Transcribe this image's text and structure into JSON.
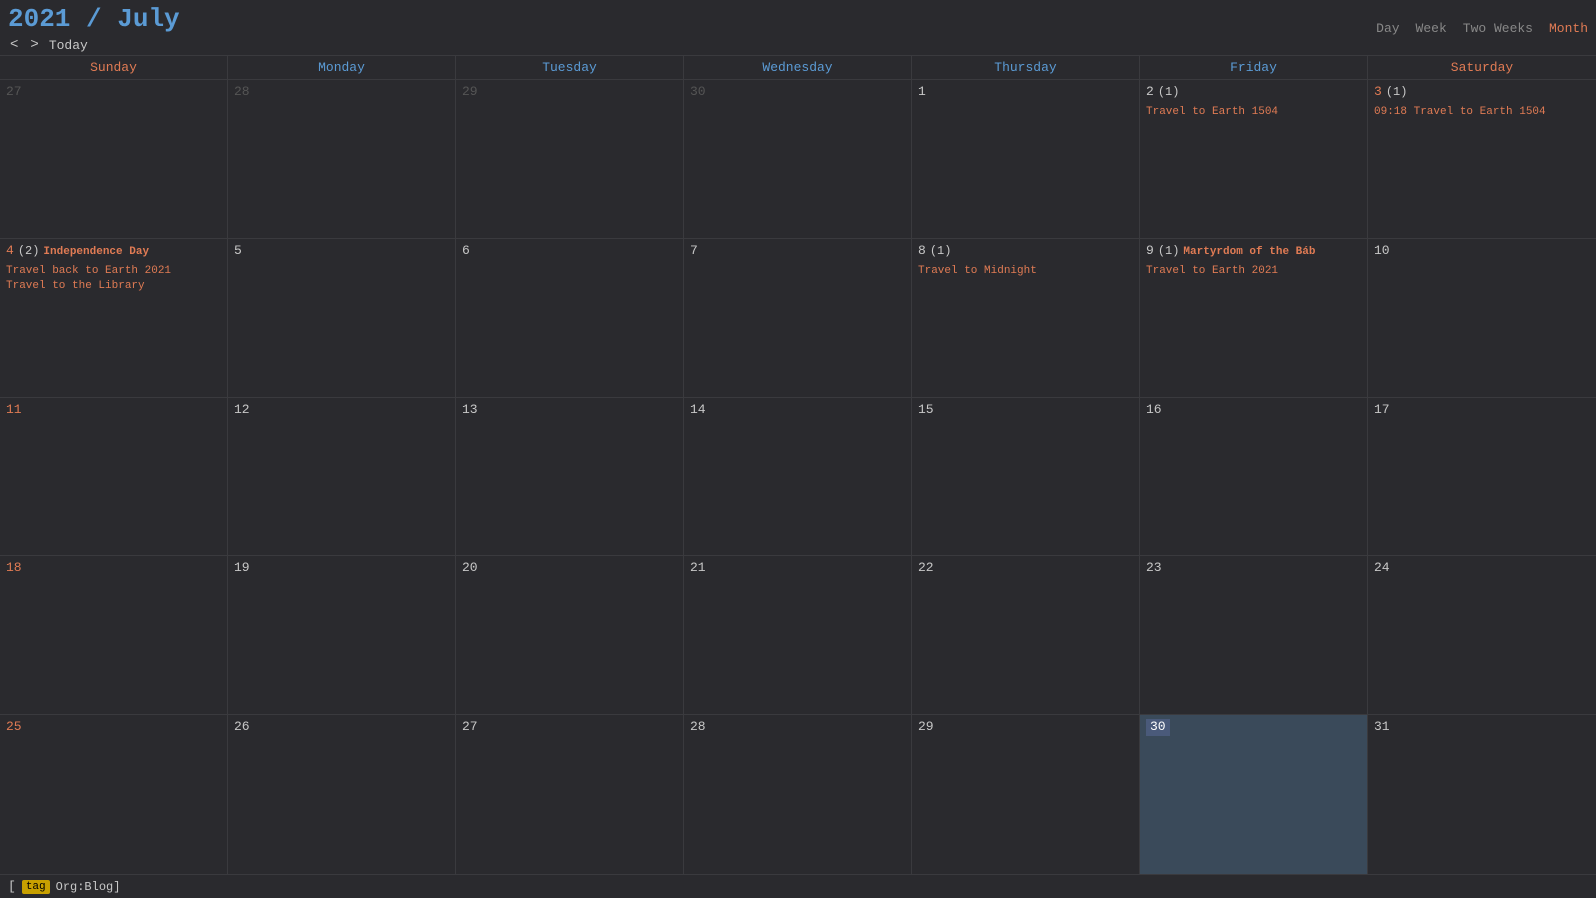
{
  "header": {
    "title_year": "2021",
    "title_sep": " / ",
    "title_month": "July",
    "nav_prev": "<",
    "nav_next": ">",
    "nav_today": "Today"
  },
  "view_switcher": {
    "day": "Day",
    "week": "Week",
    "two_weeks": "Two Weeks",
    "month": "Month"
  },
  "day_headers": [
    {
      "label": "Sunday",
      "type": "weekend"
    },
    {
      "label": "Monday",
      "type": "weekday"
    },
    {
      "label": "Tuesday",
      "type": "weekday"
    },
    {
      "label": "Wednesday",
      "type": "weekday"
    },
    {
      "label": "Thursday",
      "type": "weekday"
    },
    {
      "label": "Friday",
      "type": "weekday"
    },
    {
      "label": "Saturday",
      "type": "weekend"
    }
  ],
  "weeks": [
    [
      {
        "num": "27",
        "type": "other"
      },
      {
        "num": "28",
        "type": "other"
      },
      {
        "num": "29",
        "type": "other"
      },
      {
        "num": "30",
        "type": "other"
      },
      {
        "num": "1",
        "type": "current"
      },
      {
        "num": "2",
        "type": "current",
        "count": "(1)",
        "events": [
          {
            "text": "Travel to Earth 1504",
            "style": "orange"
          }
        ]
      },
      {
        "num": "3",
        "type": "weekend",
        "count": "(1)",
        "events": [
          {
            "text": "09:18 Travel to Earth 1504",
            "style": "orange"
          }
        ]
      }
    ],
    [
      {
        "num": "4",
        "type": "weekend",
        "count": "(2)",
        "events": [
          {
            "text": "Independence Day",
            "style": "bold-orange"
          },
          {
            "text": "Travel back to Earth 2021",
            "style": "orange"
          },
          {
            "text": "Travel to the Library",
            "style": "orange"
          }
        ]
      },
      {
        "num": "5",
        "type": "current"
      },
      {
        "num": "6",
        "type": "current"
      },
      {
        "num": "7",
        "type": "current"
      },
      {
        "num": "8",
        "type": "current",
        "count": "(1)",
        "events": [
          {
            "text": "Travel to Midnight",
            "style": "orange"
          }
        ]
      },
      {
        "num": "9",
        "type": "current",
        "count": "(1)",
        "events": [
          {
            "text": "Martyrdom of the Báb",
            "style": "bold-orange"
          },
          {
            "text": "Travel to Earth 2021",
            "style": "orange"
          }
        ]
      },
      {
        "num": "10",
        "type": "current"
      }
    ],
    [
      {
        "num": "11",
        "type": "weekend"
      },
      {
        "num": "12",
        "type": "current"
      },
      {
        "num": "13",
        "type": "current"
      },
      {
        "num": "14",
        "type": "current"
      },
      {
        "num": "15",
        "type": "current"
      },
      {
        "num": "16",
        "type": "current"
      },
      {
        "num": "17",
        "type": "current"
      }
    ],
    [
      {
        "num": "18",
        "type": "weekend"
      },
      {
        "num": "19",
        "type": "current"
      },
      {
        "num": "20",
        "type": "current"
      },
      {
        "num": "21",
        "type": "current"
      },
      {
        "num": "22",
        "type": "current"
      },
      {
        "num": "23",
        "type": "current"
      },
      {
        "num": "24",
        "type": "current"
      }
    ],
    [
      {
        "num": "25",
        "type": "weekend"
      },
      {
        "num": "26",
        "type": "current"
      },
      {
        "num": "27",
        "type": "current"
      },
      {
        "num": "28",
        "type": "current"
      },
      {
        "num": "29",
        "type": "current"
      },
      {
        "num": "30",
        "type": "today"
      },
      {
        "num": "31",
        "type": "current"
      }
    ]
  ],
  "footer": {
    "tag": "tag",
    "label": "Org:Blog]"
  }
}
